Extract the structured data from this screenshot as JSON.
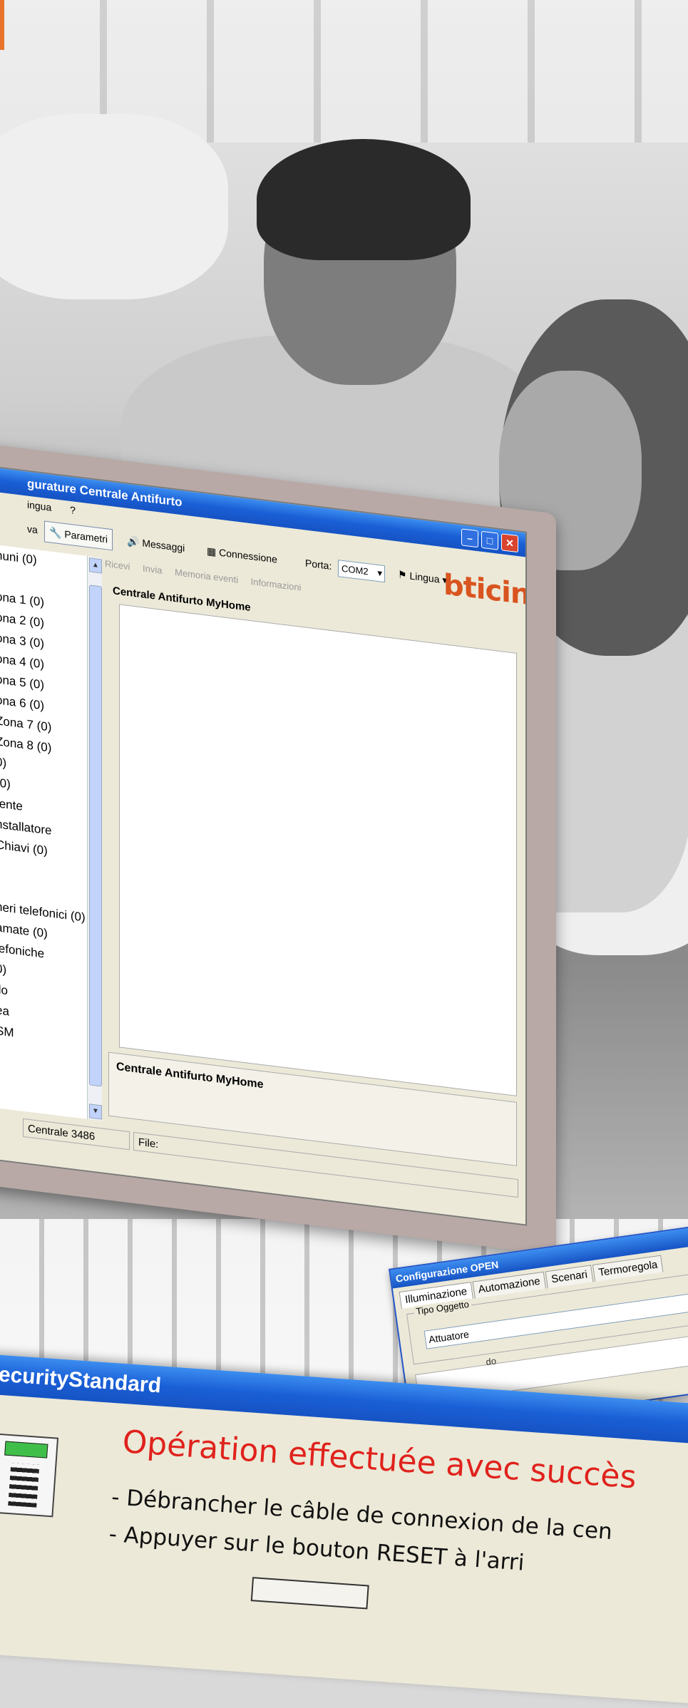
{
  "app": {
    "title": "gurature Centrale Antifurto",
    "menu": [
      "ingua",
      "?"
    ],
    "toolbar": {
      "left_label": "va",
      "parametri": "Parametri",
      "messaggi": "Messaggi",
      "connessione": "Connessione",
      "porta_label": "Porta:",
      "porta_value": "COM2",
      "lingua": "Lingua",
      "logo": "bticino"
    },
    "subtoolbar": [
      "Ricevi",
      "Invia",
      "Memoria eventi",
      "Informazioni"
    ],
    "tree_items": [
      "nuni (0)",
      ")",
      "ona 1 (0)",
      "ona 2 (0)",
      "ona 3 (0)",
      "ona 4 (0)",
      "ona 5 (0)",
      "ona 6 (0)",
      "Zona 7 (0)",
      "Zona 8 (0)",
      "0)",
      "(0)",
      "tente",
      "nstallatore",
      "Chiavi (0)",
      "",
      "",
      "neri telefonici (0)",
      "amate (0)",
      "lefoniche",
      "0)",
      "llo",
      "ea",
      "SM"
    ],
    "panel_header": "Centrale Antifurto MyHome",
    "panel_footer": "Centrale Antifurto MyHome",
    "status": {
      "centrale": "Centrale 3486",
      "file": "File:"
    }
  },
  "config_open": {
    "title": "Configurazione OPEN",
    "tabs": [
      "Illuminazione",
      "Automazione",
      "Scenari",
      "Termoregola"
    ],
    "group_label": "Tipo Oggetto",
    "value": "Attuatore",
    "second_label": "do"
  },
  "security": {
    "title": "ecurityStandard",
    "headline": "Opération effectuée avec succès",
    "lines": [
      "- Débrancher le câble de connexion de la cen",
      "- Appuyer sur le bouton RESET à l'arri"
    ]
  },
  "colors": {
    "xp_blue": "#1a5fd6",
    "success_red": "#e0221c",
    "brand_orange": "#d9541f",
    "strip_orange": "#e8742b"
  }
}
